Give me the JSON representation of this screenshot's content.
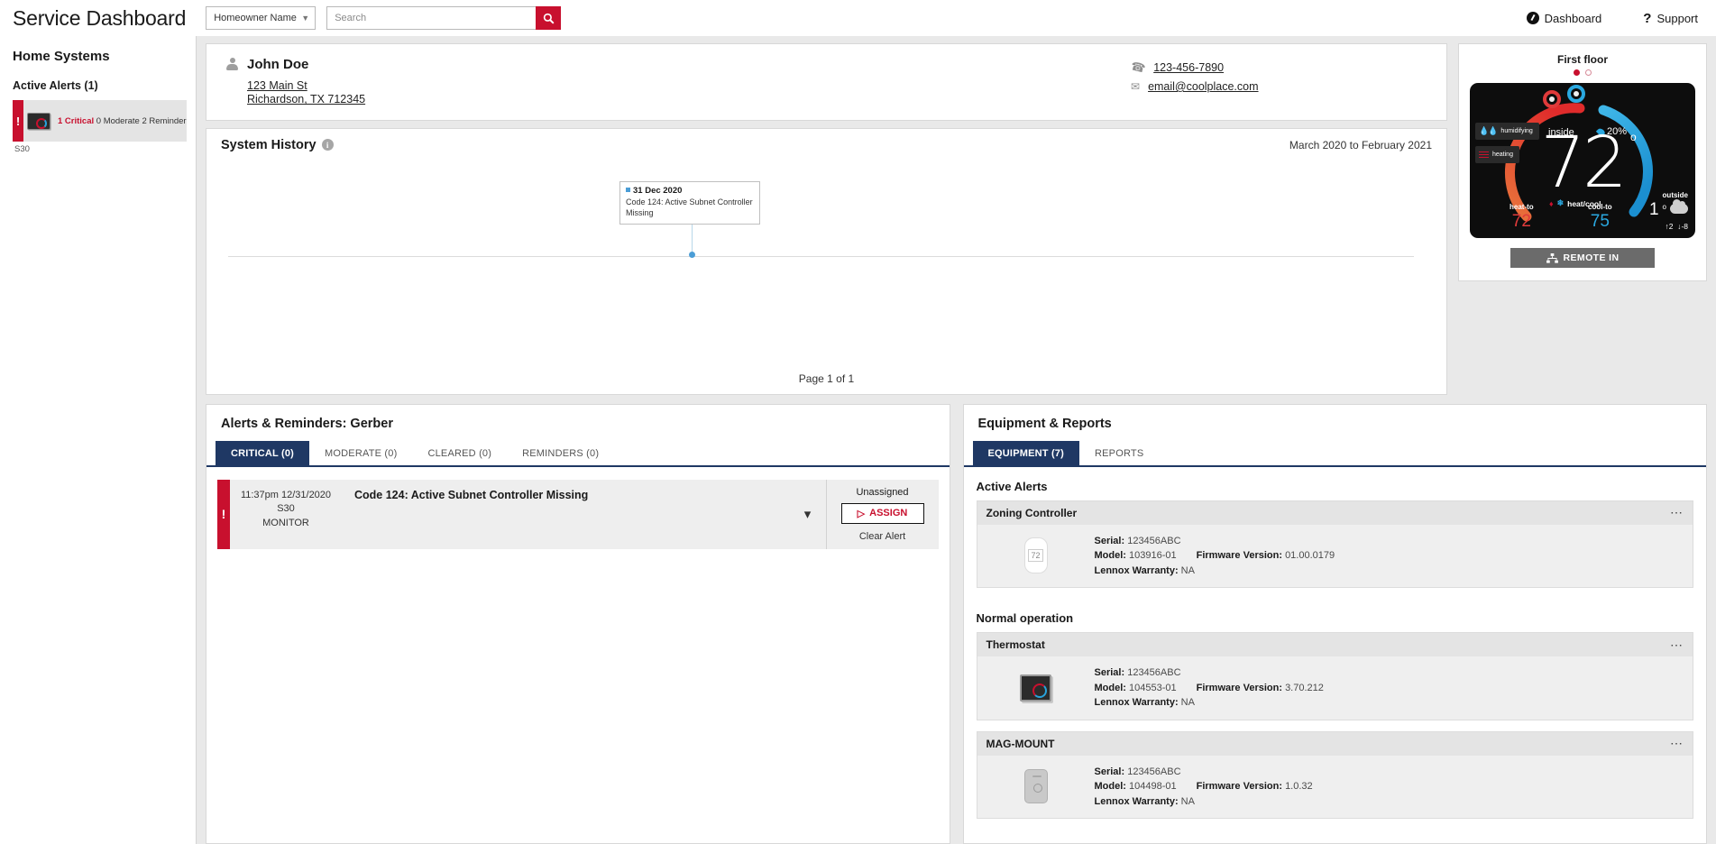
{
  "header": {
    "app_title": "Service Dashboard",
    "filter_select": {
      "value": "Homeowner Name",
      "chevron": "chevron-down-icon"
    },
    "search": {
      "placeholder": "Search",
      "value": "",
      "button_icon": "search-icon"
    },
    "links": [
      {
        "label": "Dashboard",
        "icon": "dashboard-icon"
      },
      {
        "label": "Support",
        "icon": "question-mark-icon"
      }
    ],
    "accent_color": "#c8102e"
  },
  "sidebar": {
    "title": "Home Systems",
    "active_alerts_label": "Active Alerts (1)",
    "system": {
      "bang": "!",
      "critical": "1 Critical",
      "moderate": "0 Moderate",
      "reminder": "2 Reminder",
      "model": "S30"
    }
  },
  "customer": {
    "name": "John Doe",
    "address_line1": "123 Main St",
    "address_line2": "Richardson, TX 712345",
    "phone": "123-456-7890",
    "email": "email@coolplace.com"
  },
  "history": {
    "title": "System History",
    "info_icon": "info-icon",
    "range": "March 2020 to February 2021",
    "event": {
      "date": "31 Dec 2020",
      "description": "Code 124: Active Subnet Controller Missing"
    },
    "page": "Page 1 of 1"
  },
  "thermostat": {
    "floor_label": "First floor",
    "inside_label": "inside",
    "humidity": "20%",
    "temperature": "72",
    "degree": "o",
    "badge_humidifying": "humidifying",
    "badge_heating": "heating",
    "mode": "heat/cool",
    "heat_to_label": "heat-to",
    "heat_to_value": "72",
    "cool_to_label": "cool-to",
    "cool_to_value": "75",
    "outside_label": "outside",
    "outside_temp": "1",
    "outside_degree": "o",
    "outside_high": "2",
    "outside_low": "-8",
    "remote_button": "REMOTE IN",
    "remote_icon": "network-icon",
    "heat_color": "#e03a3a",
    "cool_color": "#2aa8e0"
  },
  "alerts": {
    "title": "Alerts & Reminders: Gerber",
    "tabs": [
      {
        "label": "CRITICAL  (0)",
        "active": true
      },
      {
        "label": "MODERATE  (0)",
        "active": false
      },
      {
        "label": "CLEARED  (0)",
        "active": false
      },
      {
        "label": "REMINDERS  (0)",
        "active": false
      }
    ],
    "rows": [
      {
        "bang": "!",
        "timestamp": "11:37pm 12/31/2020",
        "device": "S30",
        "source": "MONITOR",
        "description": "Code 124: Active Subnet Controller Missing",
        "chevron": "chevron-down-icon",
        "assignment": "Unassigned",
        "assign_label": "ASSIGN",
        "assign_icon": "paper-plane-icon",
        "clear_label": "Clear Alert"
      }
    ]
  },
  "equipment": {
    "title": "Equipment & Reports",
    "tabs": [
      {
        "label": "EQUIPMENT (7)",
        "active": true
      },
      {
        "label": "REPORTS",
        "active": false
      }
    ],
    "sections": [
      {
        "heading": "Active Alerts",
        "items": [
          {
            "name": "Zoning Controller",
            "thumb": "zoning-controller-thumb",
            "serial_label": "Serial:",
            "serial": "123456ABC",
            "model_label": "Model:",
            "model": "103916-01",
            "firmware_label": "Firmware Version:",
            "firmware": "01.00.0179",
            "warranty_label": "Lennox Warranty:",
            "warranty": "NA",
            "menu_icon": "more-options-icon"
          }
        ]
      },
      {
        "heading": "Normal operation",
        "items": [
          {
            "name": "Thermostat",
            "thumb": "thermostat-thumb",
            "serial_label": "Serial:",
            "serial": "123456ABC",
            "model_label": "Model:",
            "model": "104553-01",
            "firmware_label": "Firmware Version:",
            "firmware": "3.70.212",
            "warranty_label": "Lennox Warranty:",
            "warranty": "NA",
            "menu_icon": "more-options-icon"
          },
          {
            "name": "MAG-MOUNT",
            "thumb": "mag-mount-thumb",
            "serial_label": "Serial:",
            "serial": "123456ABC",
            "model_label": "Model:",
            "model": "104498-01",
            "firmware_label": "Firmware Version:",
            "firmware": "1.0.32",
            "warranty_label": "Lennox Warranty:",
            "warranty": "NA",
            "menu_icon": "more-options-icon"
          }
        ]
      }
    ]
  }
}
